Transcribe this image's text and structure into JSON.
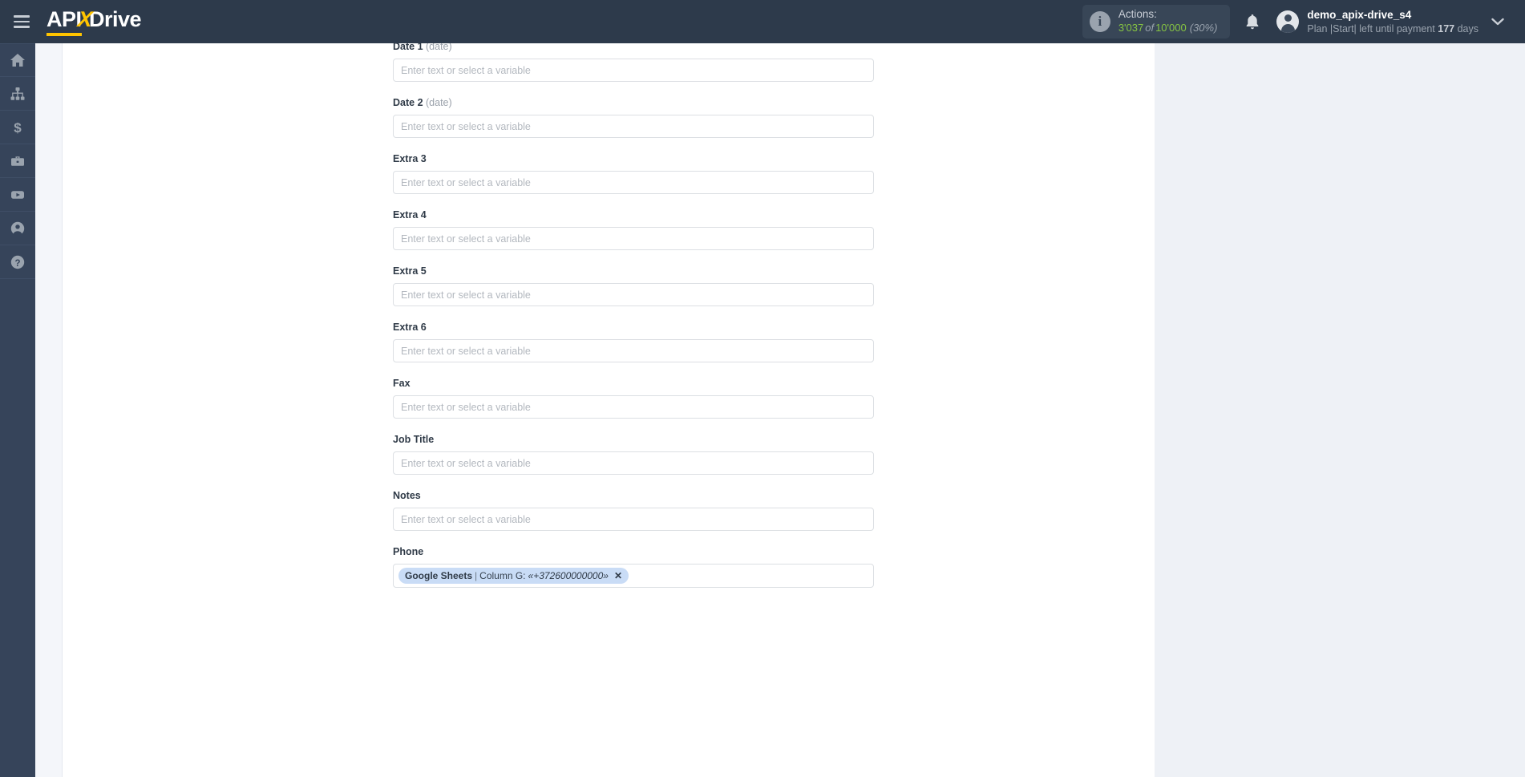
{
  "app": {
    "brand_api": "API",
    "brand_x": "X",
    "brand_drive": "Drive"
  },
  "header": {
    "menu_icon": "hamburger-icon",
    "actions": {
      "info_icon": "info-icon",
      "label": "Actions:",
      "used": "3'037",
      "of": "of",
      "total": "10'000",
      "percent": "(30%)"
    },
    "bell_icon": "bell-icon",
    "user": {
      "name": "demo_apix-drive_s4",
      "plan_prefix": "Plan |Start| left until payment",
      "days": "177",
      "days_suffix": "days"
    },
    "chevron_icon": "chevron-down-icon"
  },
  "sidebar": {
    "items": [
      {
        "icon": "home-icon",
        "name": "sidebar-item-home"
      },
      {
        "icon": "connections-icon",
        "name": "sidebar-item-connections"
      },
      {
        "icon": "dollar-icon",
        "name": "sidebar-item-billing"
      },
      {
        "icon": "briefcase-icon",
        "name": "sidebar-item-business"
      },
      {
        "icon": "youtube-icon",
        "name": "sidebar-item-video"
      },
      {
        "icon": "user-circle-icon",
        "name": "sidebar-item-account"
      },
      {
        "icon": "help-icon",
        "name": "sidebar-item-help"
      }
    ]
  },
  "form": {
    "placeholder": "Enter text or select a variable",
    "fields": [
      {
        "label": "Date 1",
        "hint": "(date)",
        "value": null
      },
      {
        "label": "Date 2",
        "hint": "(date)",
        "value": null
      },
      {
        "label": "Extra 3",
        "hint": "",
        "value": null
      },
      {
        "label": "Extra 4",
        "hint": "",
        "value": null
      },
      {
        "label": "Extra 5",
        "hint": "",
        "value": null
      },
      {
        "label": "Extra 6",
        "hint": "",
        "value": null
      },
      {
        "label": "Fax",
        "hint": "",
        "value": null
      },
      {
        "label": "Job Title",
        "hint": "",
        "value": null
      },
      {
        "label": "Notes",
        "hint": "",
        "value": null
      }
    ],
    "phone_field": {
      "label": "Phone",
      "tag": {
        "source": "Google Sheets",
        "separator": "|",
        "column": "Column G:",
        "value": "«+372600000000»",
        "remove": "✕"
      }
    }
  },
  "colors": {
    "topbar_bg": "#2d3a4b",
    "rail_bg": "#36445a",
    "brand_accent": "#ffc400",
    "actions_green": "#86c442",
    "tag_bg": "#c9dcf6",
    "panel_bg": "#eef1f6"
  }
}
